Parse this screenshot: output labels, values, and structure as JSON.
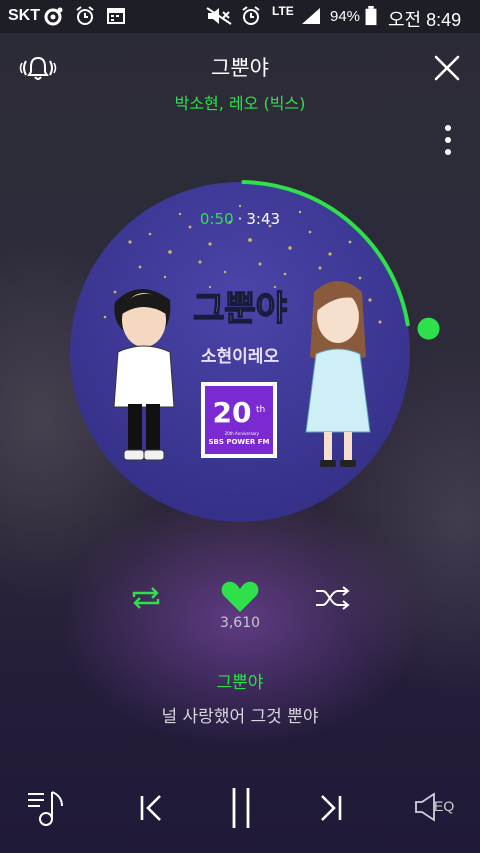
{
  "status_bar": {
    "carrier": "SKT",
    "battery_percent": "94%",
    "time": "오전 8:49",
    "network": "LTE"
  },
  "song": {
    "title": "그뿐야",
    "artist": "박소현, 레오 (빅스)"
  },
  "playback": {
    "current_time": "0:50",
    "separator": "·",
    "total_time": "3:43",
    "progress_fraction": 0.224
  },
  "album_art": {
    "title_text": "그뿐야",
    "subtitle_text": "소현이레오",
    "badge_number": "20",
    "badge_suffix": "th",
    "badge_small": "20th Anniversary",
    "badge_label": "SBS POWER FM"
  },
  "actions": {
    "like_count": "3,610",
    "eq_label": "EQ"
  },
  "lyrics": {
    "title": "그뿐야",
    "current_line": "널 사랑했어 그것 뿐야"
  },
  "colors": {
    "accent": "#2ee04a",
    "art_bg": "#3a3590"
  },
  "icons": {
    "alarm": "alarm-bell-icon",
    "close": "close-icon",
    "more": "more-vertical-icon",
    "repeat": "repeat-icon",
    "like": "heart-icon",
    "shuffle": "shuffle-icon",
    "playlist": "playlist-icon",
    "prev": "previous-icon",
    "pause": "pause-icon",
    "next": "next-icon",
    "eq": "equalizer-icon"
  }
}
